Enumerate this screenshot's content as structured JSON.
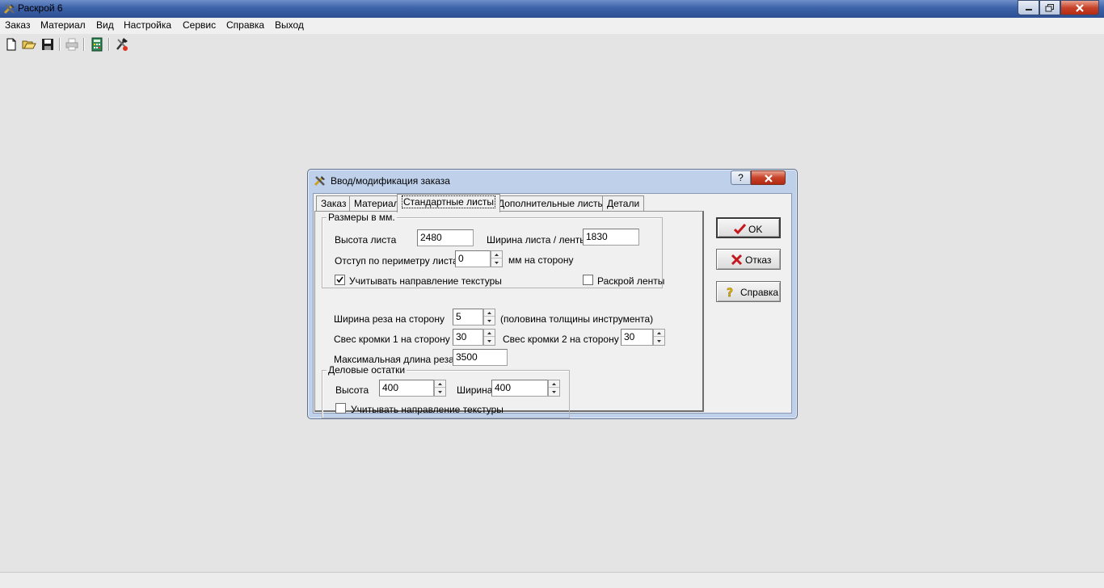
{
  "window": {
    "title": "Раскрой 6"
  },
  "menu": {
    "items": [
      "Заказ",
      "Материал",
      "Вид",
      "Настройка",
      "Сервис",
      "Справка",
      "Выход"
    ]
  },
  "toolbar": {
    "icons": [
      "new-document-icon",
      "open-folder-icon",
      "save-disk-icon",
      "print-icon",
      "calculator-icon",
      "cut-tool-icon"
    ]
  },
  "dialog": {
    "title": "Ввод/модификация заказа",
    "help_glyph": "?",
    "tabs": [
      "Заказ",
      "Материал",
      "Стандартные листы",
      "Дополнительные листы",
      "Детали"
    ],
    "active_tab": 2,
    "sizes_group": {
      "label": "Размеры в мм.",
      "sheet_height_label": "Высота листа",
      "sheet_height_value": "2480",
      "sheet_width_label": "Ширина листа / ленты",
      "sheet_width_value": "1830",
      "perimeter_offset_label": "Отступ по периметру листа",
      "perimeter_offset_value": "0",
      "perimeter_offset_unit": "мм на сторону",
      "texture_direction_label": "Учитывать направление текстуры",
      "texture_direction_checked": true,
      "tape_cut_label": "Раскрой ленты",
      "tape_cut_checked": false
    },
    "cut_width_label": "Ширина реза на сторону",
    "cut_width_value": "5",
    "cut_width_note": "(половина толщины инструмента)",
    "edge1_label": "Свес кромки 1 на сторону",
    "edge1_value": "30",
    "edge2_label": "Свес кромки 2 на сторону",
    "edge2_value": "30",
    "max_cut_label": "Максимальная длина реза",
    "max_cut_value": "3500",
    "offcuts_group": {
      "label": "Деловые остатки",
      "height_label": "Высота",
      "height_value": "400",
      "width_label": "Ширина",
      "width_value": "400",
      "texture_direction_label": "Учитывать направление текстуры",
      "texture_direction_checked": false
    },
    "buttons": {
      "ok": "OK",
      "cancel": "Отказ",
      "help": "Справка"
    }
  },
  "colors": {
    "title_bar": "#3c62a8",
    "dialog_frame": "#bfd1ea",
    "face": "#f0f0f0",
    "close_red": "#c7432a"
  }
}
